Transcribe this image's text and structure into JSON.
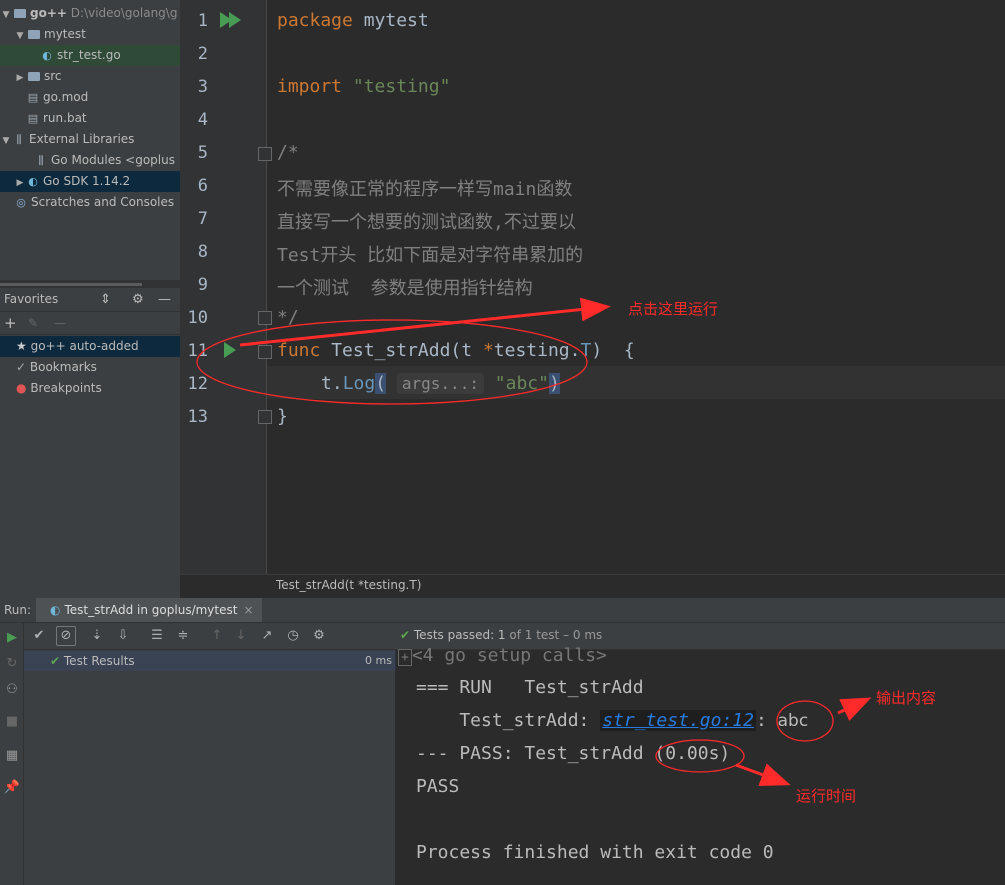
{
  "project_tree": {
    "items": [
      {
        "label": "go++",
        "path": "D:\\video\\golang\\g",
        "indent": 0,
        "arrow": "▼",
        "kind": "folder"
      },
      {
        "label": "mytest",
        "indent": 1,
        "arrow": "▼",
        "kind": "folder"
      },
      {
        "label": "str_test.go",
        "indent": 2,
        "arrow": "",
        "kind": "gofile"
      },
      {
        "label": "src",
        "indent": 1,
        "arrow": "▶",
        "kind": "folder"
      },
      {
        "label": "go.mod",
        "indent": 1,
        "arrow": "",
        "kind": "file"
      },
      {
        "label": "run.bat",
        "indent": 1,
        "arrow": "",
        "kind": "file"
      },
      {
        "label": "External Libraries",
        "indent": 0,
        "arrow": "▼",
        "kind": "lib"
      },
      {
        "label": "Go Modules <goplus",
        "indent": 1,
        "arrow": "",
        "kind": "lib"
      },
      {
        "label": "Go SDK 1.14.2",
        "indent": 1,
        "arrow": "▶",
        "kind": "sdk"
      },
      {
        "label": "Scratches and Consoles",
        "indent": 0,
        "arrow": "",
        "kind": "scratch"
      }
    ]
  },
  "favorites": {
    "title": "Favorites",
    "items": [
      {
        "label": "go++  auto-added",
        "icon": "★"
      },
      {
        "label": "Bookmarks",
        "icon": "✓"
      },
      {
        "label": "Breakpoints",
        "icon": "●"
      }
    ]
  },
  "editor": {
    "line_numbers": [
      "1",
      "2",
      "3",
      "4",
      "5",
      "6",
      "7",
      "8",
      "9",
      "10",
      "11",
      "12",
      "13"
    ],
    "line1": {
      "kw": "package",
      "rest": " mytest"
    },
    "line3": {
      "kw": "import",
      "str": "\"testing\""
    },
    "line5": "/*",
    "line6": "不需要像正常的程序一样写main函数",
    "line7": "直接写一个想要的测试函数,不过要以",
    "line8": "Test开头 比如下面是对字符串累加的",
    "line9": "一个测试  参数是使用指针结构",
    "line10": "*/",
    "line11": {
      "kw": "func",
      "name": "Test_strAdd",
      "sig_a": "(t ",
      "star": "*",
      "sig_b": "testing.",
      "type": "T",
      "sig_c": ")  {"
    },
    "line12": {
      "recv": "t.",
      "call": "Log",
      "open": "(",
      "hint": "args...:",
      "str": "\"abc\"",
      "close": ")"
    },
    "line13": "}",
    "breadcrumb": "Test_strAdd(t *testing.T)"
  },
  "run_panel": {
    "label": "Run:",
    "tab": "Test_strAdd in goplus/mytest",
    "tab_close": "×",
    "status": {
      "prefix": "Tests passed: ",
      "count": "1",
      "suffix": " of 1 test – 0 ms"
    },
    "test_results": {
      "label": "Test Results",
      "time": "0 ms"
    },
    "console": {
      "setup": "<4 go setup calls>",
      "run_line": "=== RUN   Test_strAdd",
      "log_prefix": "    Test_strAdd: ",
      "log_link": "str_test.go:12",
      "log_sep": ": ",
      "log_value": "abc",
      "pass_line": "--- PASS: Test_strAdd (0.00s)",
      "pass": "PASS",
      "exit": "Process finished with exit code 0"
    }
  },
  "annotations": {
    "run_here": "点击这里运行",
    "output": "输出内容",
    "run_time": "运行时间"
  },
  "colors": {
    "accent_green": "#499c54",
    "annotation_red": "#ff2a2a",
    "keyword": "#cc7832",
    "string": "#6a8759"
  }
}
